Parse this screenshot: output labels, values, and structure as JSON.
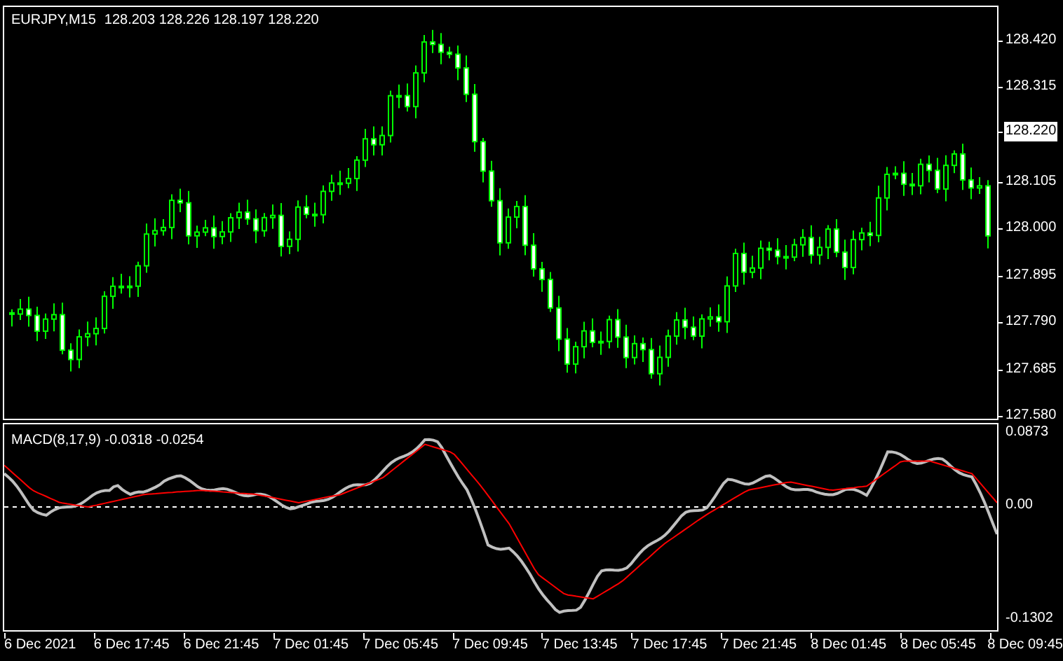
{
  "header": {
    "symbol": "EURJPY,M15",
    "open": "128.203",
    "high": "128.226",
    "low": "128.197",
    "close": "128.220"
  },
  "price_axis": {
    "labels": [
      {
        "text": "128.420",
        "kind": "tick"
      },
      {
        "text": "128.315",
        "kind": "tick"
      },
      {
        "text": "128.220",
        "kind": "current"
      },
      {
        "text": "128.105",
        "kind": "tick"
      },
      {
        "text": "128.000",
        "kind": "tick"
      },
      {
        "text": "127.895",
        "kind": "tick"
      },
      {
        "text": "127.790",
        "kind": "tick"
      },
      {
        "text": "127.685",
        "kind": "tick"
      },
      {
        "text": "127.580",
        "kind": "tick"
      }
    ]
  },
  "macd": {
    "title": "MACD(8,17,9)",
    "macd_value": "-0.0318",
    "signal_value": "-0.0254",
    "axis_labels": [
      {
        "text": "0.0873",
        "kind": "top"
      },
      {
        "text": "0.00",
        "kind": "zero"
      },
      {
        "text": "-0.1302",
        "kind": "bottom"
      }
    ]
  },
  "time_axis": [
    "6 Dec 2021",
    "6 Dec 17:45",
    "6 Dec 21:45",
    "7 Dec 01:45",
    "7 Dec 05:45",
    "7 Dec 09:45",
    "7 Dec 13:45",
    "7 Dec 17:45",
    "7 Dec 21:45",
    "8 Dec 01:45",
    "8 Dec 05:45",
    "8 Dec 09:45"
  ]
}
